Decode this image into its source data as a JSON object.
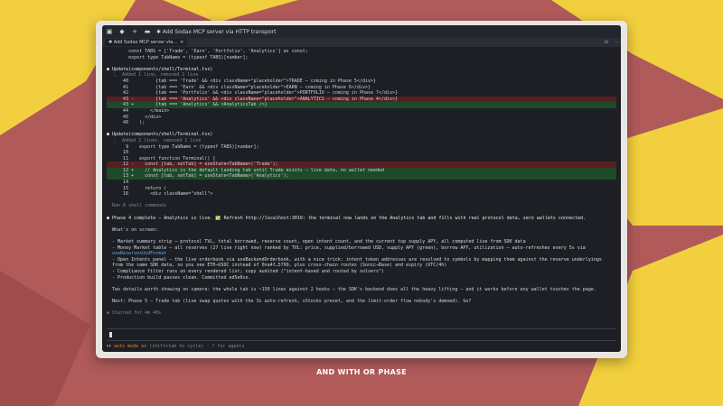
{
  "title_bar": {
    "title": "✱ Add Sodax MCP server via HTTP transport"
  },
  "tab": {
    "label": "✱ Add Sodax MCP server via..."
  },
  "terminal": {
    "lines": [
      {
        "t": "        const TABS = ['Trade', 'Earn', 'Portfolio', 'Analytics'] as const;",
        "c": ""
      },
      {
        "t": "        export type TabName = (typeof TABS)[number];",
        "c": ""
      },
      {
        "t": "",
        "c": ""
      },
      {
        "t": "● Update(components/shell/Terminal.tsx)",
        "c": "head"
      },
      {
        "t": "  ⎿  Added 1 line, removed 1 line",
        "c": "dim"
      },
      {
        "t": "      40          {tab === 'Trade' && <div className=\"placeholder\">TRADE — coming in Phase 5</div>}",
        "c": ""
      },
      {
        "t": "      41          {tab === 'Earn' && <div className=\"placeholder\">EARN — coming in Phase 6</div>}",
        "c": ""
      },
      {
        "t": "      42          {tab === 'Portfolio' && <div className=\"placeholder\">PORTFOLIO — coming in Phase 7</div>}",
        "c": ""
      },
      {
        "t": "      43 -        {tab === 'Analytics' && <div className=\"placeholder\">ANALYTICS — coming in Phase 4</div>}",
        "c": "del"
      },
      {
        "t": "      43 +        {tab === 'Analytics' && <AnalyticsTab />}",
        "c": "add"
      },
      {
        "t": "      44        </main>",
        "c": ""
      },
      {
        "t": "      45      </div>",
        "c": ""
      },
      {
        "t": "      46    );",
        "c": ""
      },
      {
        "t": "",
        "c": ""
      },
      {
        "t": "● Update(components/shell/Terminal.tsx)",
        "c": "head"
      },
      {
        "t": "  ⎿  Added 2 lines, removed 1 line",
        "c": "dim"
      },
      {
        "t": "       9    export type TabName = (typeof TABS)[number];",
        "c": ""
      },
      {
        "t": "      10",
        "c": ""
      },
      {
        "t": "      11    export function Terminal() {",
        "c": ""
      },
      {
        "t": "      12 -    const [tab, setTab] = useState<TabName>('Trade');",
        "c": "del"
      },
      {
        "t": "      12 +    // Analytics is the default landing tab until Trade exists — live data, no wallet needed",
        "c": "add"
      },
      {
        "t": "      13 +    const [tab, setTab] = useState<TabName>('Analytics');",
        "c": "add"
      },
      {
        "t": "      14",
        "c": ""
      },
      {
        "t": "      15      return (",
        "c": ""
      },
      {
        "t": "      16        <div className=\"shell\">",
        "c": ""
      },
      {
        "t": "",
        "c": ""
      },
      {
        "t": "  Ran 8 shell commands",
        "c": "dim"
      },
      {
        "t": "",
        "c": ""
      },
      {
        "t": "● Phase 4 complete — Analytics is live. ✅ Refresh http://localhost:3010: the terminal now lands on the Analytics tab and fills with real protocol data, zero wallets connected.",
        "c": "head"
      },
      {
        "t": "",
        "c": ""
      },
      {
        "t": "  What's on screen:",
        "c": ""
      },
      {
        "t": "",
        "c": ""
      },
      {
        "t": "  - Market summary strip — protocol TVL, total borrowed, reserve count, open intent count, and the current top supply APY, all computed live from SDK data",
        "c": "bul"
      },
      {
        "t": "  - Money Market table — all reserves (27 live right now) ranked by TVL: price, supplied/borrowed USD, supply APY (green), borrow APY, utilization — auto-refreshes every 5s via",
        "c": "bul"
      },
      {
        "t": "  useReservesUsdFormat",
        "c": "link"
      },
      {
        "t": "  - Open Intents panel — the live orderbook via useBackendOrderbook, with a nice trick: intent token addresses are resolved to symbols by mapping them against the reserve underlyings",
        "c": "bul"
      },
      {
        "t": "  from the same SDK data, so you see ETH→USDC instead of 0xa4f…5799, plus cross-chain routes (Sonic→Base) and expiry (UTC/4h)",
        "c": "bul"
      },
      {
        "t": "  - Compliance filter runs on every rendered list; copy audited (\"intent-based and routed by solvers\")",
        "c": "bul"
      },
      {
        "t": "  - Production build passes clean. Committed ed5e0ce.",
        "c": "bul"
      },
      {
        "t": "",
        "c": ""
      },
      {
        "t": "  Two details worth showing on camera: the whole tab is ~150 lines against 2 hooks — the SDK's backend does all the heavy lifting — and it works before any wallet touches the page.",
        "c": ""
      },
      {
        "t": "",
        "c": ""
      },
      {
        "t": "  Next: Phase 5 — Trade tab (live swap quotes with the 3s auto-refresh, xStocks preset, and the limit-order flow nobody's demoed). Go?",
        "c": ""
      },
      {
        "t": "",
        "c": ""
      },
      {
        "t": "✱ Churned for 4m 40s",
        "c": "dim"
      }
    ],
    "status_text": "⏵⏵ auto mode on",
    "status_hint": " (shift+tab to cycle) · ? for agents"
  },
  "caption": "AND WITH OR PHASE"
}
